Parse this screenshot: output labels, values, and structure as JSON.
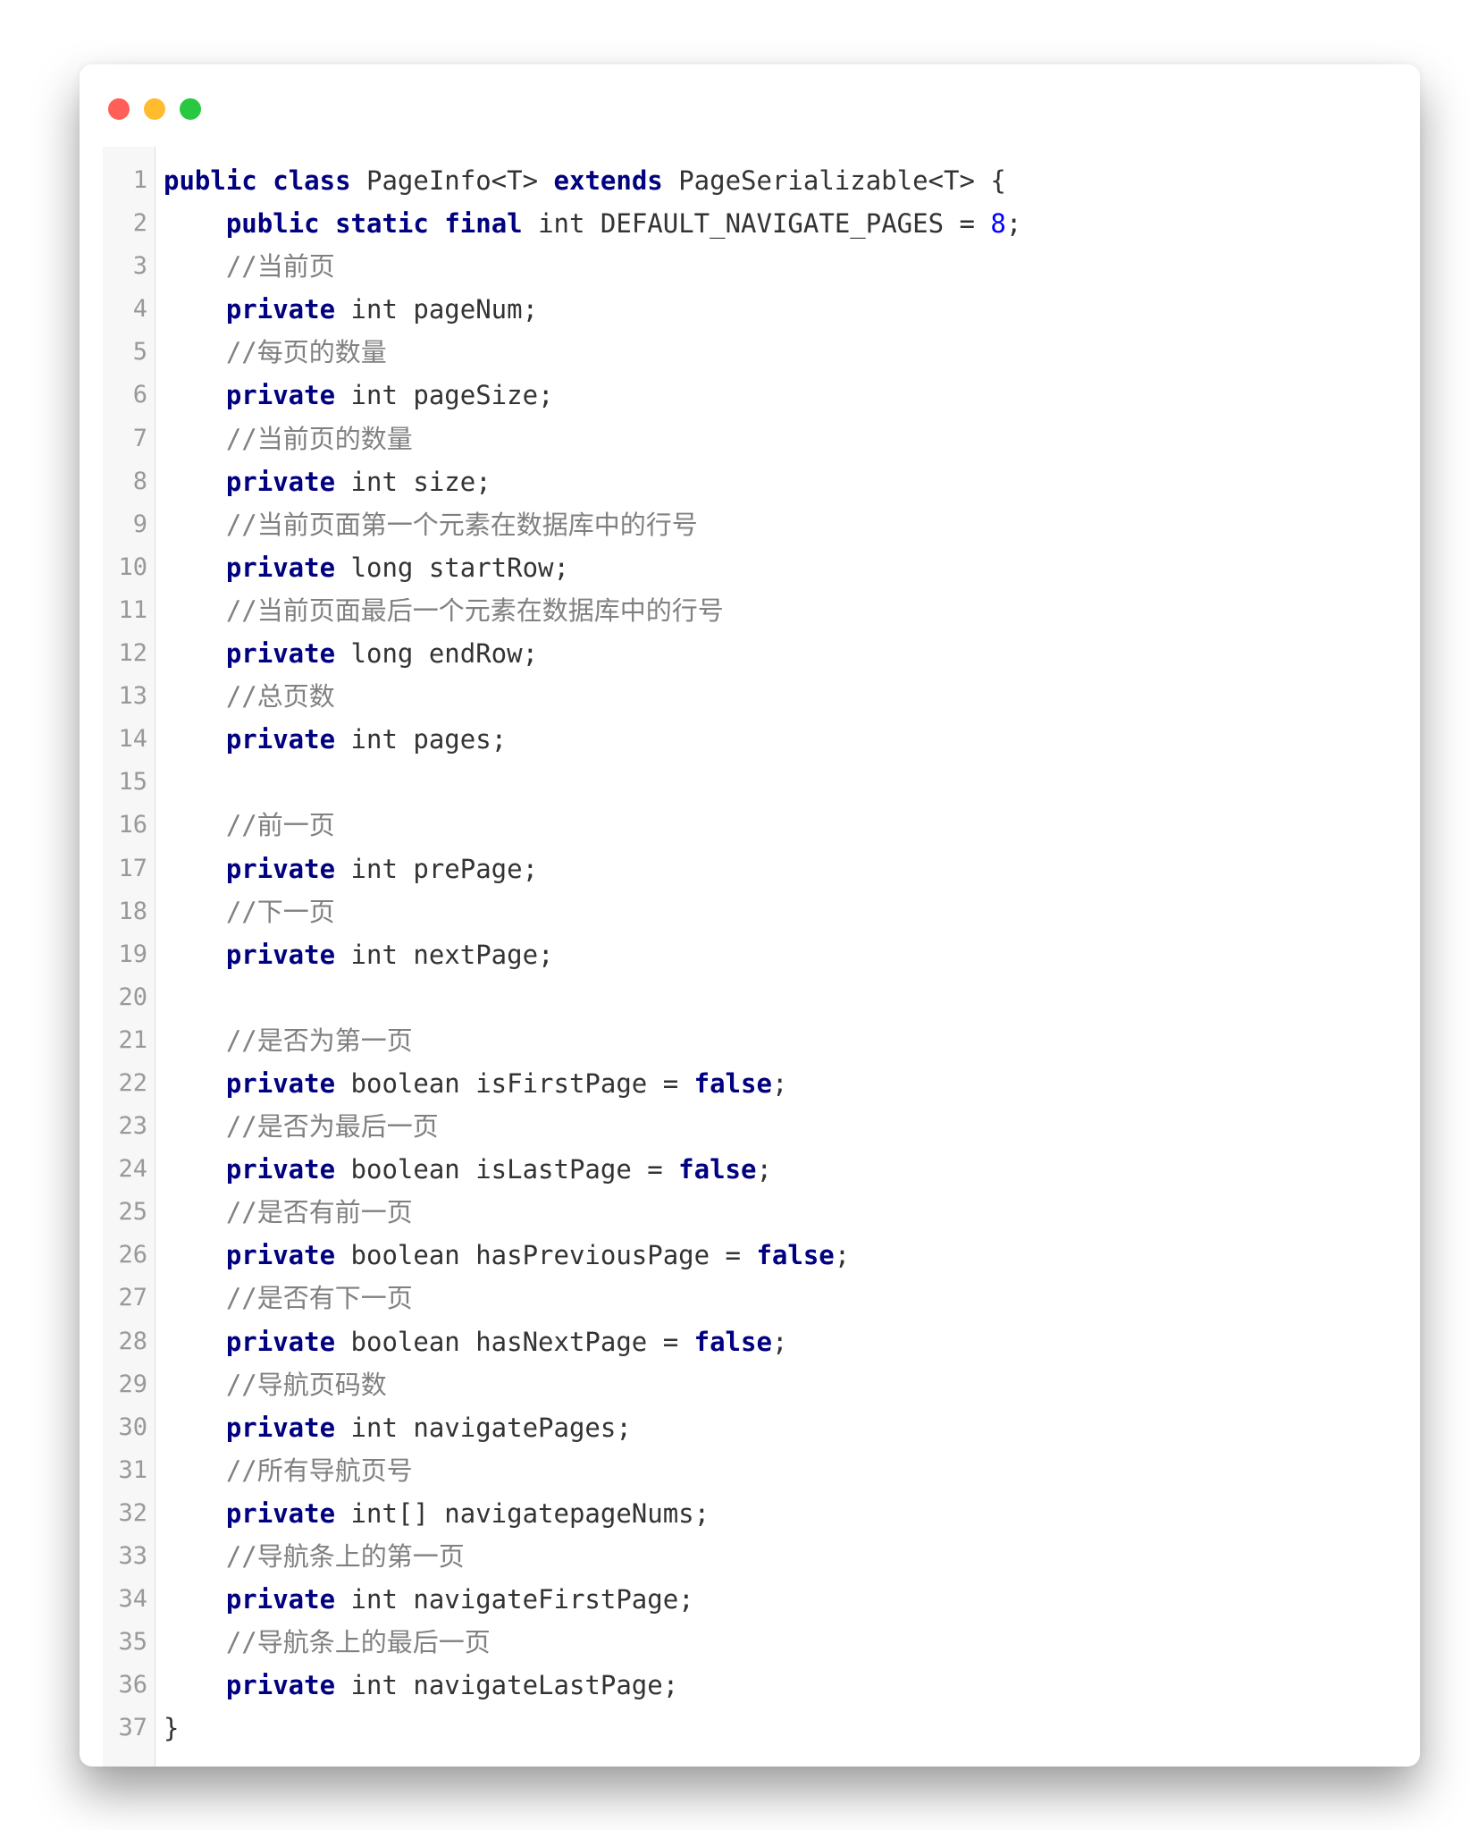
{
  "window": {
    "controls": {
      "close_color": "#ff5f57",
      "minimize_color": "#febc2e",
      "maximize_color": "#28c840"
    }
  },
  "editor": {
    "language": "java",
    "theme": {
      "keyword_color": "#000080",
      "number_color": "#0000ff",
      "comment_color": "#808080",
      "text_color": "#333333",
      "line_number_color": "#999999"
    },
    "lines": [
      {
        "n": "1",
        "tokens": [
          {
            "t": "kw",
            "v": "public"
          },
          {
            "t": "tx",
            "v": " "
          },
          {
            "t": "kw",
            "v": "class"
          },
          {
            "t": "tx",
            "v": " PageInfo<T> "
          },
          {
            "t": "kw",
            "v": "extends"
          },
          {
            "t": "tx",
            "v": " PageSerializable<T> {"
          }
        ]
      },
      {
        "n": "2",
        "tokens": [
          {
            "t": "tx",
            "v": "    "
          },
          {
            "t": "kw",
            "v": "public"
          },
          {
            "t": "tx",
            "v": " "
          },
          {
            "t": "kw",
            "v": "static"
          },
          {
            "t": "tx",
            "v": " "
          },
          {
            "t": "kw",
            "v": "final"
          },
          {
            "t": "tx",
            "v": " int DEFAULT_NAVIGATE_PAGES = "
          },
          {
            "t": "num",
            "v": "8"
          },
          {
            "t": "tx",
            "v": ";"
          }
        ]
      },
      {
        "n": "3",
        "tokens": [
          {
            "t": "tx",
            "v": "    "
          },
          {
            "t": "cm",
            "v": "//当前页"
          }
        ]
      },
      {
        "n": "4",
        "tokens": [
          {
            "t": "tx",
            "v": "    "
          },
          {
            "t": "kw",
            "v": "private"
          },
          {
            "t": "tx",
            "v": " int pageNum;"
          }
        ]
      },
      {
        "n": "5",
        "tokens": [
          {
            "t": "tx",
            "v": "    "
          },
          {
            "t": "cm",
            "v": "//每页的数量"
          }
        ]
      },
      {
        "n": "6",
        "tokens": [
          {
            "t": "tx",
            "v": "    "
          },
          {
            "t": "kw",
            "v": "private"
          },
          {
            "t": "tx",
            "v": " int pageSize;"
          }
        ]
      },
      {
        "n": "7",
        "tokens": [
          {
            "t": "tx",
            "v": "    "
          },
          {
            "t": "cm",
            "v": "//当前页的数量"
          }
        ]
      },
      {
        "n": "8",
        "tokens": [
          {
            "t": "tx",
            "v": "    "
          },
          {
            "t": "kw",
            "v": "private"
          },
          {
            "t": "tx",
            "v": " int size;"
          }
        ]
      },
      {
        "n": "9",
        "tokens": [
          {
            "t": "tx",
            "v": "    "
          },
          {
            "t": "cm",
            "v": "//当前页面第一个元素在数据库中的行号"
          }
        ]
      },
      {
        "n": "10",
        "tokens": [
          {
            "t": "tx",
            "v": "    "
          },
          {
            "t": "kw",
            "v": "private"
          },
          {
            "t": "tx",
            "v": " long startRow;"
          }
        ]
      },
      {
        "n": "11",
        "tokens": [
          {
            "t": "tx",
            "v": "    "
          },
          {
            "t": "cm",
            "v": "//当前页面最后一个元素在数据库中的行号"
          }
        ]
      },
      {
        "n": "12",
        "tokens": [
          {
            "t": "tx",
            "v": "    "
          },
          {
            "t": "kw",
            "v": "private"
          },
          {
            "t": "tx",
            "v": " long endRow;"
          }
        ]
      },
      {
        "n": "13",
        "tokens": [
          {
            "t": "tx",
            "v": "    "
          },
          {
            "t": "cm",
            "v": "//总页数"
          }
        ]
      },
      {
        "n": "14",
        "tokens": [
          {
            "t": "tx",
            "v": "    "
          },
          {
            "t": "kw",
            "v": "private"
          },
          {
            "t": "tx",
            "v": " int pages;"
          }
        ]
      },
      {
        "n": "15",
        "tokens": []
      },
      {
        "n": "16",
        "tokens": [
          {
            "t": "tx",
            "v": "    "
          },
          {
            "t": "cm",
            "v": "//前一页"
          }
        ]
      },
      {
        "n": "17",
        "tokens": [
          {
            "t": "tx",
            "v": "    "
          },
          {
            "t": "kw",
            "v": "private"
          },
          {
            "t": "tx",
            "v": " int prePage;"
          }
        ]
      },
      {
        "n": "18",
        "tokens": [
          {
            "t": "tx",
            "v": "    "
          },
          {
            "t": "cm",
            "v": "//下一页"
          }
        ]
      },
      {
        "n": "19",
        "tokens": [
          {
            "t": "tx",
            "v": "    "
          },
          {
            "t": "kw",
            "v": "private"
          },
          {
            "t": "tx",
            "v": " int nextPage;"
          }
        ]
      },
      {
        "n": "20",
        "tokens": []
      },
      {
        "n": "21",
        "tokens": [
          {
            "t": "tx",
            "v": "    "
          },
          {
            "t": "cm",
            "v": "//是否为第一页"
          }
        ]
      },
      {
        "n": "22",
        "tokens": [
          {
            "t": "tx",
            "v": "    "
          },
          {
            "t": "kw",
            "v": "private"
          },
          {
            "t": "tx",
            "v": " boolean isFirstPage = "
          },
          {
            "t": "kw",
            "v": "false"
          },
          {
            "t": "tx",
            "v": ";"
          }
        ]
      },
      {
        "n": "23",
        "tokens": [
          {
            "t": "tx",
            "v": "    "
          },
          {
            "t": "cm",
            "v": "//是否为最后一页"
          }
        ]
      },
      {
        "n": "24",
        "tokens": [
          {
            "t": "tx",
            "v": "    "
          },
          {
            "t": "kw",
            "v": "private"
          },
          {
            "t": "tx",
            "v": " boolean isLastPage = "
          },
          {
            "t": "kw",
            "v": "false"
          },
          {
            "t": "tx",
            "v": ";"
          }
        ]
      },
      {
        "n": "25",
        "tokens": [
          {
            "t": "tx",
            "v": "    "
          },
          {
            "t": "cm",
            "v": "//是否有前一页"
          }
        ]
      },
      {
        "n": "26",
        "tokens": [
          {
            "t": "tx",
            "v": "    "
          },
          {
            "t": "kw",
            "v": "private"
          },
          {
            "t": "tx",
            "v": " boolean hasPreviousPage = "
          },
          {
            "t": "kw",
            "v": "false"
          },
          {
            "t": "tx",
            "v": ";"
          }
        ]
      },
      {
        "n": "27",
        "tokens": [
          {
            "t": "tx",
            "v": "    "
          },
          {
            "t": "cm",
            "v": "//是否有下一页"
          }
        ]
      },
      {
        "n": "28",
        "tokens": [
          {
            "t": "tx",
            "v": "    "
          },
          {
            "t": "kw",
            "v": "private"
          },
          {
            "t": "tx",
            "v": " boolean hasNextPage = "
          },
          {
            "t": "kw",
            "v": "false"
          },
          {
            "t": "tx",
            "v": ";"
          }
        ]
      },
      {
        "n": "29",
        "tokens": [
          {
            "t": "tx",
            "v": "    "
          },
          {
            "t": "cm",
            "v": "//导航页码数"
          }
        ]
      },
      {
        "n": "30",
        "tokens": [
          {
            "t": "tx",
            "v": "    "
          },
          {
            "t": "kw",
            "v": "private"
          },
          {
            "t": "tx",
            "v": " int navigatePages;"
          }
        ]
      },
      {
        "n": "31",
        "tokens": [
          {
            "t": "tx",
            "v": "    "
          },
          {
            "t": "cm",
            "v": "//所有导航页号"
          }
        ]
      },
      {
        "n": "32",
        "tokens": [
          {
            "t": "tx",
            "v": "    "
          },
          {
            "t": "kw",
            "v": "private"
          },
          {
            "t": "tx",
            "v": " int[] navigatepageNums;"
          }
        ]
      },
      {
        "n": "33",
        "tokens": [
          {
            "t": "tx",
            "v": "    "
          },
          {
            "t": "cm",
            "v": "//导航条上的第一页"
          }
        ]
      },
      {
        "n": "34",
        "tokens": [
          {
            "t": "tx",
            "v": "    "
          },
          {
            "t": "kw",
            "v": "private"
          },
          {
            "t": "tx",
            "v": " int navigateFirstPage;"
          }
        ]
      },
      {
        "n": "35",
        "tokens": [
          {
            "t": "tx",
            "v": "    "
          },
          {
            "t": "cm",
            "v": "//导航条上的最后一页"
          }
        ]
      },
      {
        "n": "36",
        "tokens": [
          {
            "t": "tx",
            "v": "    "
          },
          {
            "t": "kw",
            "v": "private"
          },
          {
            "t": "tx",
            "v": " int navigateLastPage;"
          }
        ]
      },
      {
        "n": "37",
        "tokens": [
          {
            "t": "tx",
            "v": "}"
          }
        ]
      }
    ]
  }
}
